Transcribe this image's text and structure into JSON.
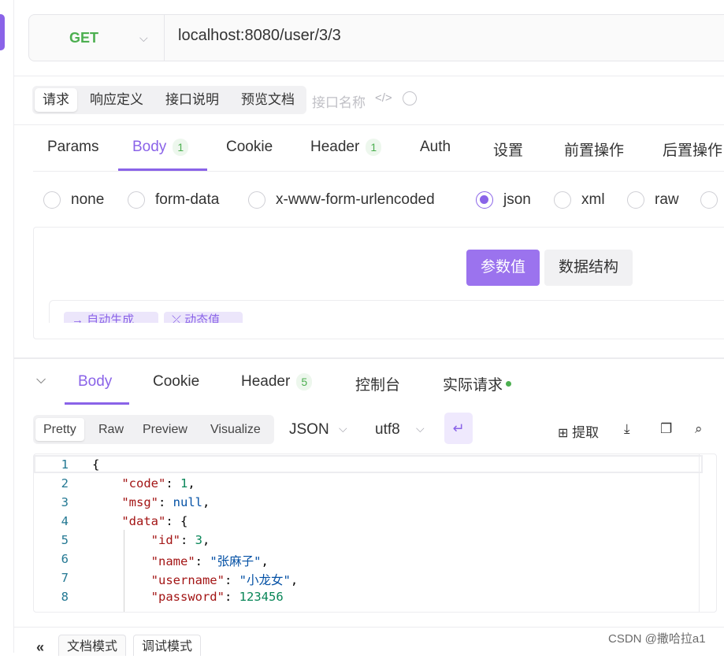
{
  "request": {
    "method": "GET",
    "url": "localhost:8080/user/3/3"
  },
  "top_tabs": [
    "请求",
    "响应定义",
    "接口说明",
    "预览文档"
  ],
  "name_placeholder": "接口名称",
  "request_tabs": [
    {
      "label": "Params",
      "badge": ""
    },
    {
      "label": "Body",
      "badge": "1"
    },
    {
      "label": "Cookie",
      "badge": ""
    },
    {
      "label": "Header",
      "badge": "1"
    },
    {
      "label": "Auth",
      "badge": ""
    },
    {
      "label": "设置",
      "badge": ""
    },
    {
      "label": "前置操作",
      "badge": ""
    },
    {
      "label": "后置操作",
      "badge": ""
    }
  ],
  "body_types": [
    "none",
    "form-data",
    "x-www-form-urlencoded",
    "json",
    "xml",
    "raw"
  ],
  "selected_body_type": "json",
  "param_toggle": [
    "参数值",
    "数据结构"
  ],
  "partial_chips": [
    "→ 自动生成",
    "⤫ 动态值"
  ],
  "response_tabs": [
    {
      "label": "Body",
      "badge": ""
    },
    {
      "label": "Cookie",
      "badge": ""
    },
    {
      "label": "Header",
      "badge": "5"
    },
    {
      "label": "控制台",
      "badge": ""
    },
    {
      "label": "实际请求",
      "badge": ""
    }
  ],
  "view_modes": [
    "Pretty",
    "Raw",
    "Preview",
    "Visualize"
  ],
  "format": "JSON",
  "encoding": "utf8",
  "extract_label": "提取",
  "code_lines": [
    {
      "n": "1",
      "t": "{"
    },
    {
      "n": "2",
      "t": "    \"code\": 1,"
    },
    {
      "n": "3",
      "t": "    \"msg\": null,"
    },
    {
      "n": "4",
      "t": "    \"data\": {"
    },
    {
      "n": "5",
      "t": "        \"id\": 3,"
    },
    {
      "n": "6",
      "t": "        \"name\": \"张麻子\","
    },
    {
      "n": "7",
      "t": "        \"username\": \"小龙女\","
    },
    {
      "n": "8",
      "t": "        \"password\": 123456"
    }
  ],
  "bottom_tabs": [
    "文档模式",
    "调试模式"
  ],
  "watermark": "CSDN @撒哈拉a1",
  "colors": {
    "accent": "#8a63e8",
    "get_method": "#4caf50"
  }
}
